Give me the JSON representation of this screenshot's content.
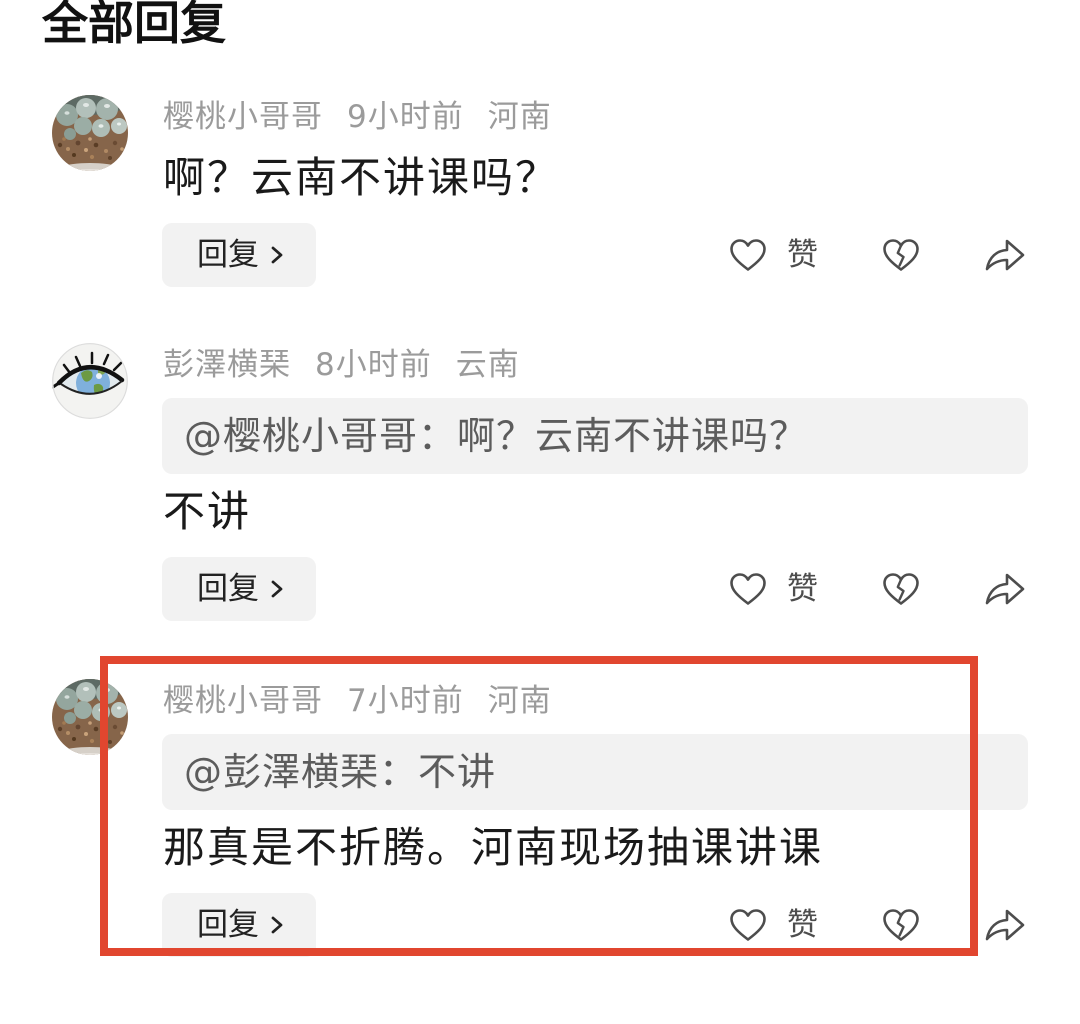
{
  "header": {
    "title": "全部回复"
  },
  "colors": {
    "page-bg": "#ffffff",
    "title": "#111111",
    "text-primary": "#1a1a1a",
    "text-meta": "#9b9b9b",
    "quote-text": "#5c5c5c",
    "bubble-bg": "#f2f2f2",
    "button-text": "#222222",
    "icon": "#4d4d4d",
    "annotation": "#e1462f"
  },
  "icons": {
    "reply": "chevron-right-icon",
    "like": "heart-icon",
    "dislike": "broken-heart-icon",
    "share": "share-icon"
  },
  "comments": [
    {
      "username": "樱桃小哥哥",
      "time": "9小时前",
      "location": "河南",
      "content": "啊？云南不讲课吗？",
      "reply_label": "回复",
      "like_label": "赞"
    },
    {
      "username": "彭澤横琹",
      "time": "8小时前",
      "location": "云南",
      "quote": "@樱桃小哥哥：啊？云南不讲课吗？",
      "content": "不讲",
      "reply_label": "回复",
      "like_label": "赞"
    },
    {
      "username": "樱桃小哥哥",
      "time": "7小时前",
      "location": "河南",
      "quote": "@彭澤横琹：不讲",
      "content": "那真是不折腾。河南现场抽课讲课",
      "reply_label": "回复",
      "like_label": "赞"
    }
  ]
}
